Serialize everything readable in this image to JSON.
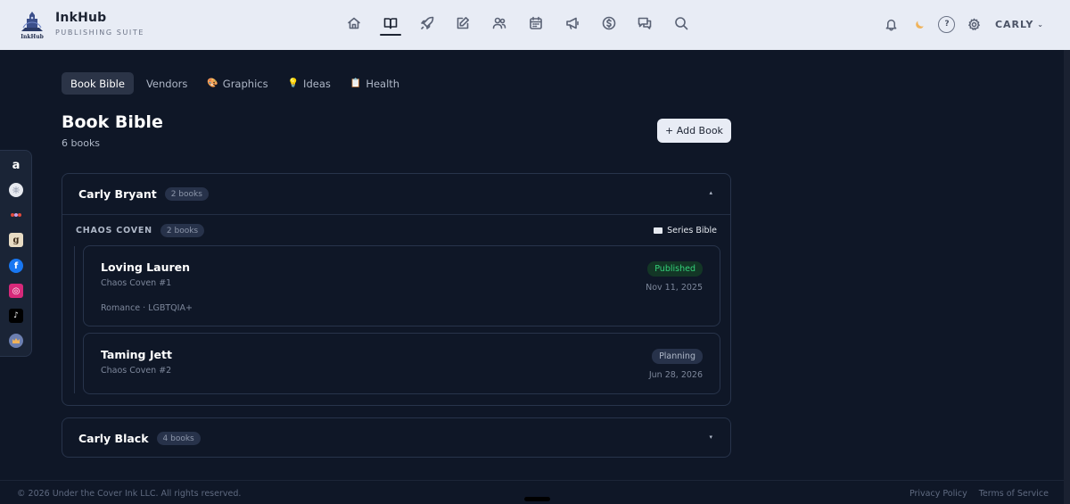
{
  "brand": {
    "name": "InkHub",
    "subtitle": "PUBLISHING SUITE",
    "logo_word": "InkHub"
  },
  "nav": [
    {
      "icon": "home-icon"
    },
    {
      "icon": "book-open-icon",
      "active": true
    },
    {
      "icon": "rocket-icon"
    },
    {
      "icon": "pencil-icon"
    },
    {
      "icon": "users-icon"
    },
    {
      "icon": "calendar-icon"
    },
    {
      "icon": "megaphone-icon"
    },
    {
      "icon": "dollar-icon"
    },
    {
      "icon": "chat-icon"
    },
    {
      "icon": "search-icon"
    }
  ],
  "header": {
    "help": "?",
    "user": "CARLY",
    "user_chevron": "⌄"
  },
  "social": [
    "amazon-icon",
    "apple-books-icon",
    "bookbub-icon",
    "goodreads-icon",
    "facebook-icon",
    "instagram-icon",
    "tiktok-icon",
    "kobo-icon"
  ],
  "social_glyphs": {
    "amazon": "a",
    "goodreads": "g",
    "facebook": "f",
    "instagram": "◎",
    "tiktok": "♪"
  },
  "subtabs": [
    {
      "label": "Book Bible",
      "icon": "",
      "active": true
    },
    {
      "label": "Vendors",
      "icon": ""
    },
    {
      "label": "Graphics",
      "icon": "🎨"
    },
    {
      "label": "Ideas",
      "icon": "💡"
    },
    {
      "label": "Health",
      "icon": "📋"
    }
  ],
  "page": {
    "title": "Book Bible",
    "count": "6 books",
    "add_button": "+ Add Book"
  },
  "authors": [
    {
      "name": "Carly Bryant",
      "count": "2 books",
      "toggle": "▴",
      "series": {
        "name": "CHAOS COVEN",
        "count": "2 books",
        "bible_label": "Series Bible",
        "books": [
          {
            "title": "Loving Lauren",
            "series": "Chaos Coven #1",
            "genre": "Romance · LGBTQIA+",
            "status": "Published",
            "date": "Nov 11, 2025"
          },
          {
            "title": "Taming Jett",
            "series": "Chaos Coven #2",
            "genre": "",
            "status": "Planning",
            "date": "Jun 28, 2026"
          }
        ]
      }
    },
    {
      "name": "Carly Black",
      "count": "4 books",
      "toggle": "▾"
    }
  ],
  "footer": {
    "copyright": "© 2026 Under the Cover Ink LLC. All rights reserved.",
    "privacy": "Privacy Policy",
    "terms": "Terms of Service"
  },
  "colors": {
    "background": "#0f1727",
    "header": "#e8ecf5",
    "published": "#34d27a"
  }
}
